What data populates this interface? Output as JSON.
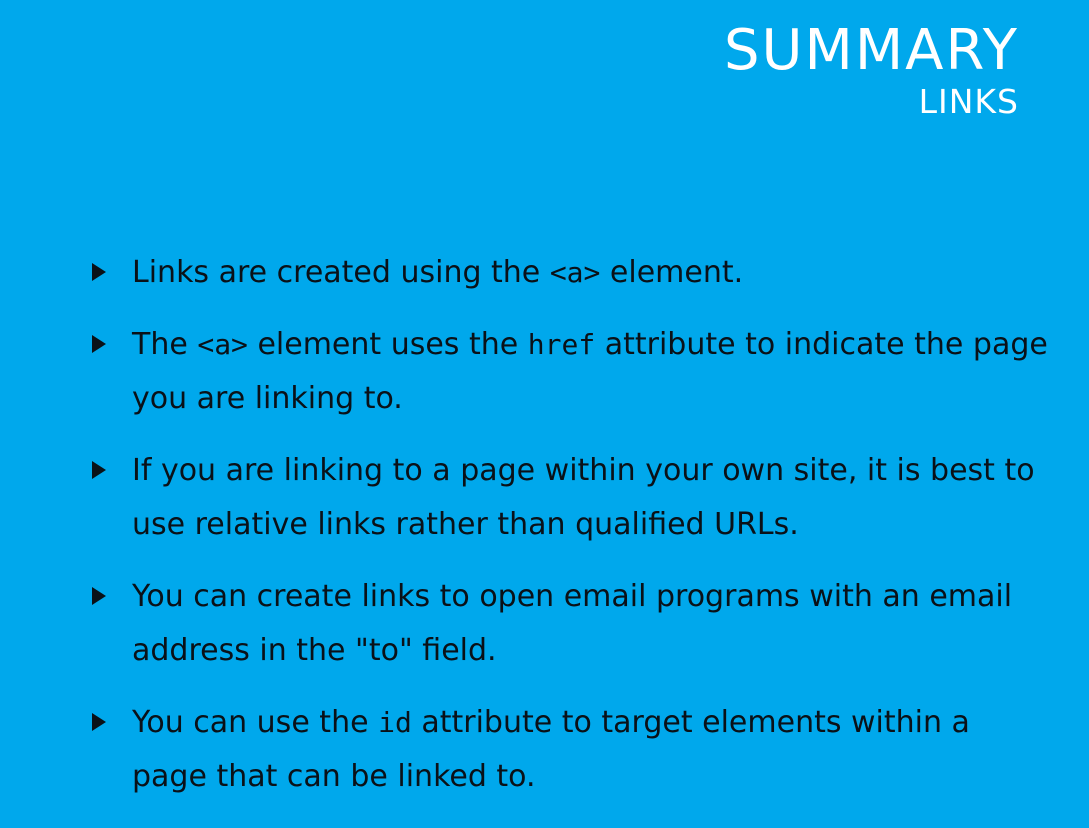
{
  "header": {
    "title": "SUMMARY",
    "subtitle": "LINKS"
  },
  "bullets": [
    {
      "icon": "triangle-right-icon",
      "parts": [
        {
          "text": "Links are created using the ",
          "code": false
        },
        {
          "text": "<a>",
          "code": true
        },
        {
          "text": " element.",
          "code": false
        }
      ]
    },
    {
      "icon": "triangle-right-icon",
      "parts": [
        {
          "text": "The ",
          "code": false
        },
        {
          "text": "<a>",
          "code": true
        },
        {
          "text": " element uses the ",
          "code": false
        },
        {
          "text": "href",
          "code": true
        },
        {
          "text": " attribute to indicate the page you are linking to.",
          "code": false
        }
      ]
    },
    {
      "icon": "triangle-right-icon",
      "parts": [
        {
          "text": "If you are linking to a page within your own site, it is best to use relative links rather than qualified URLs.",
          "code": false
        }
      ]
    },
    {
      "icon": "triangle-right-icon",
      "parts": [
        {
          "text": "You can create links to open email programs with an email address in the \"to\" field.",
          "code": false
        }
      ]
    },
    {
      "icon": "triangle-right-icon",
      "parts": [
        {
          "text": "You can use the ",
          "code": false
        },
        {
          "text": "id",
          "code": true
        },
        {
          "text": " attribute to target elements within a page that can be linked to.",
          "code": false
        }
      ]
    }
  ]
}
